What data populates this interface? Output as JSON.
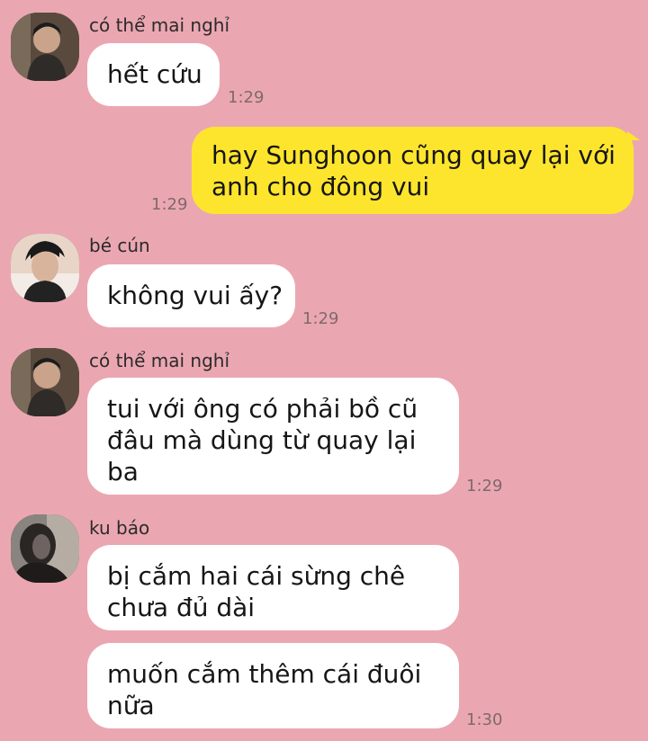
{
  "colors": {
    "background": "#eba7b1",
    "incoming_bubble": "#ffffff",
    "outgoing_bubble": "#fee52d",
    "timestamp": "#7c6a6d"
  },
  "messages": [
    {
      "sender": "có thể mai nghỉ",
      "avatar_icon": "profile-photo-icon",
      "lines": [
        "hết cứu"
      ],
      "time": "1:29"
    },
    {
      "sender": "",
      "outgoing": true,
      "lines": [
        "hay Sunghoon cũng quay lại với",
        "anh cho đông vui"
      ],
      "time": "1:29"
    },
    {
      "sender": "bé cún",
      "avatar_icon": "profile-photo-icon",
      "lines": [
        "không vui ấy?"
      ],
      "time": "1:29"
    },
    {
      "sender": "có thể mai nghỉ",
      "avatar_icon": "profile-photo-icon",
      "lines": [
        "tui với ông có phải bồ cũ",
        "đâu mà dùng từ quay lại",
        "ba"
      ],
      "time": "1:29"
    },
    {
      "sender": "ku báo",
      "avatar_icon": "profile-photo-icon",
      "lines": [
        "bị cắm hai cái sừng chê",
        "chưa đủ dài"
      ],
      "time": ""
    },
    {
      "sender": "",
      "lines": [
        "muốn cắm thêm cái đuôi",
        "nữa"
      ],
      "time": "1:30"
    }
  ]
}
